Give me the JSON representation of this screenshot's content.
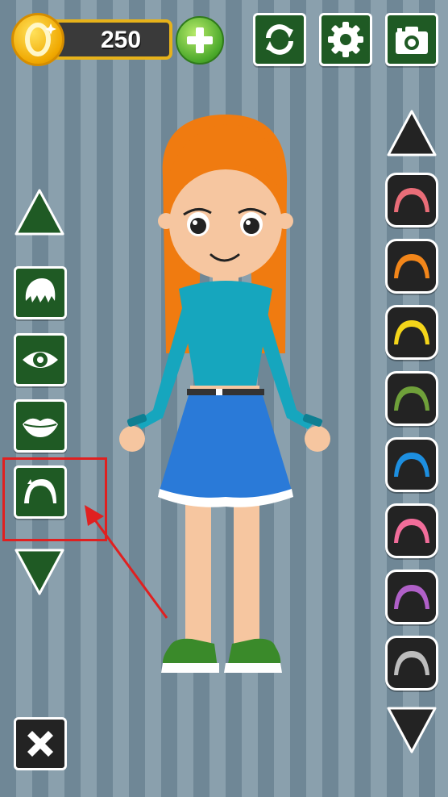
{
  "coins": {
    "value": "250",
    "icon": "coin-icon",
    "add_icon": "plus-icon"
  },
  "toolbar": {
    "buttons": [
      {
        "name": "refresh-button",
        "icon": "refresh-icon"
      },
      {
        "name": "settings-button",
        "icon": "gear-icon"
      },
      {
        "name": "camera-button",
        "icon": "camera-icon"
      }
    ]
  },
  "left_categories": {
    "up_icon": "arrow-up-icon",
    "down_icon": "arrow-down-icon",
    "items": [
      {
        "name": "hair",
        "icon": "hair-icon"
      },
      {
        "name": "eyes",
        "icon": "eye-icon"
      },
      {
        "name": "lips",
        "icon": "lips-icon"
      },
      {
        "name": "headband",
        "icon": "headband-icon",
        "selected": true
      }
    ]
  },
  "right_options": {
    "up_icon": "arrow-up-icon",
    "down_icon": "arrow-down-icon",
    "headband_colors": [
      "#e96d78",
      "#f2861a",
      "#f4d51a",
      "#6fa03a",
      "#1d8fe0",
      "#f16d9a",
      "#b060c8",
      "#bdbdbd"
    ]
  },
  "close_icon": "close-icon",
  "annotation": {
    "highlight_color": "#e02020",
    "arrow_color": "#e02020"
  },
  "character": {
    "hair_color": "#f07b10",
    "top_color": "#16a6be",
    "skirt_color": "#2a7ad8",
    "shoe_color": "#3a8a2a"
  }
}
